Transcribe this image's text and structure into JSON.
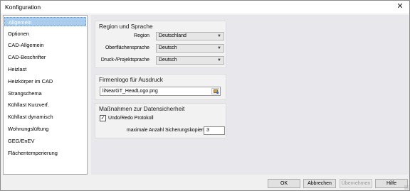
{
  "window": {
    "title": "Konfiguration",
    "close_glyph": "✕"
  },
  "sidebar": {
    "items": [
      {
        "label": "Allgemein",
        "selected": true
      },
      {
        "label": "Optionen"
      },
      {
        "label": "CAD-Allgemein"
      },
      {
        "label": "CAD-Beschrifter"
      },
      {
        "label": "Heizlast"
      },
      {
        "label": "Heizkörper im CAD"
      },
      {
        "label": "Strangschema"
      },
      {
        "label": "Kühllast Kurzverf."
      },
      {
        "label": "Kühllast dynamisch"
      },
      {
        "label": "Wohnungslüftung"
      },
      {
        "label": "GEG/EnEV"
      },
      {
        "label": "Flächentemperierung"
      }
    ]
  },
  "region": {
    "title": "Region und Sprache",
    "region_label": "Region",
    "region_value": "Deutschland",
    "ui_lang_label": "Oberflächensprache",
    "ui_lang_value": "Deutsch",
    "print_lang_label": "Druck-/Projektsprache",
    "print_lang_value": "Deutsch",
    "dropdown_glyph": "▼"
  },
  "logo": {
    "title": "Firmenlogo für Ausdruck",
    "file_value": "liNearGT_HeadLogo.png",
    "browse_icon": "image-browse-icon"
  },
  "safety": {
    "title": "Maßnahmen zur Datensicherheit",
    "undo_label": "Undo/Redo Protokoll",
    "undo_checked": true,
    "check_glyph": "✓",
    "copies_label": "maximale Anzahl Sicherungskopien",
    "copies_value": "3"
  },
  "footer": {
    "ok": "OK",
    "cancel": "Abbrechen",
    "apply": "Übernehmen",
    "help": "Hilfe"
  },
  "colors": {
    "selection": "#aacdee",
    "window_bg": "#f0f0f0",
    "content_bg": "#e8e8ec"
  }
}
